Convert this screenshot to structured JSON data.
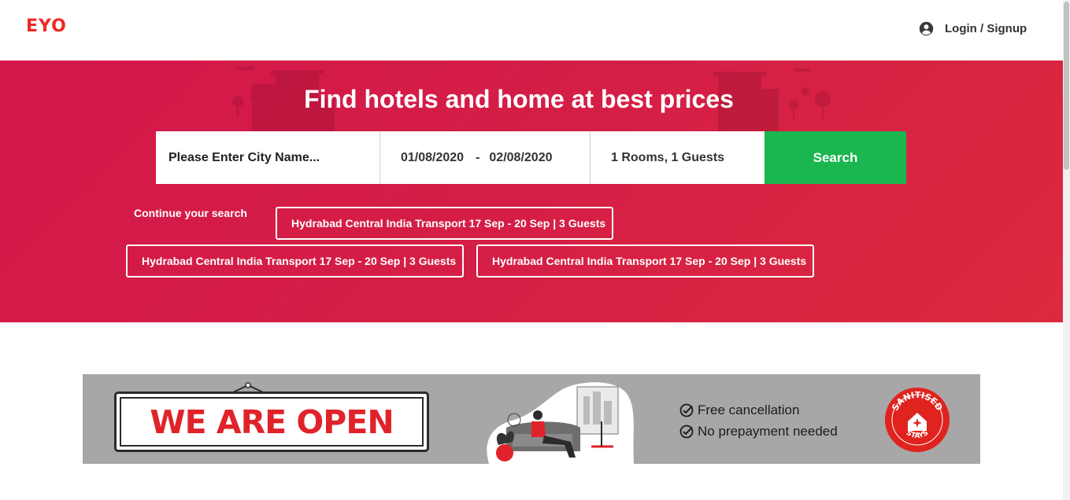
{
  "brand": {
    "logo_text": "EYO",
    "accent": "#ee2a24"
  },
  "header": {
    "login_label": "Login / Signup",
    "login_icon": "user-circle-icon"
  },
  "hero": {
    "title": "Find hotels and home at best prices",
    "gradient_colors": [
      "#d3174b",
      "#dc2a3d"
    ]
  },
  "search": {
    "city_placeholder": "Please Enter City Name...",
    "check_in": "01/08/2020",
    "date_separator": "-",
    "check_out": "02/08/2020",
    "guests": "1 Rooms, 1 Guests",
    "button_label": "Search",
    "button_color": "#1ab64f"
  },
  "recent": {
    "label": "Continue your search",
    "items": [
      "Hydrabad Central India Transport 17 Sep - 20 Sep | 3 Guests",
      "Hydrabad Central India Transport 17 Sep - 20 Sep | 3 Guests",
      "Hydrabad Central India Transport 17 Sep - 20 Sep | 3 Guests"
    ]
  },
  "promo": {
    "sign_text": "WE ARE OPEN",
    "features": [
      "Free cancellation",
      "No prepayment needed"
    ],
    "feature_icon": "check-circle-icon",
    "badge_top": "SANITISED",
    "badge_bottom": "STAYS",
    "badge_color": "#e0231f"
  }
}
